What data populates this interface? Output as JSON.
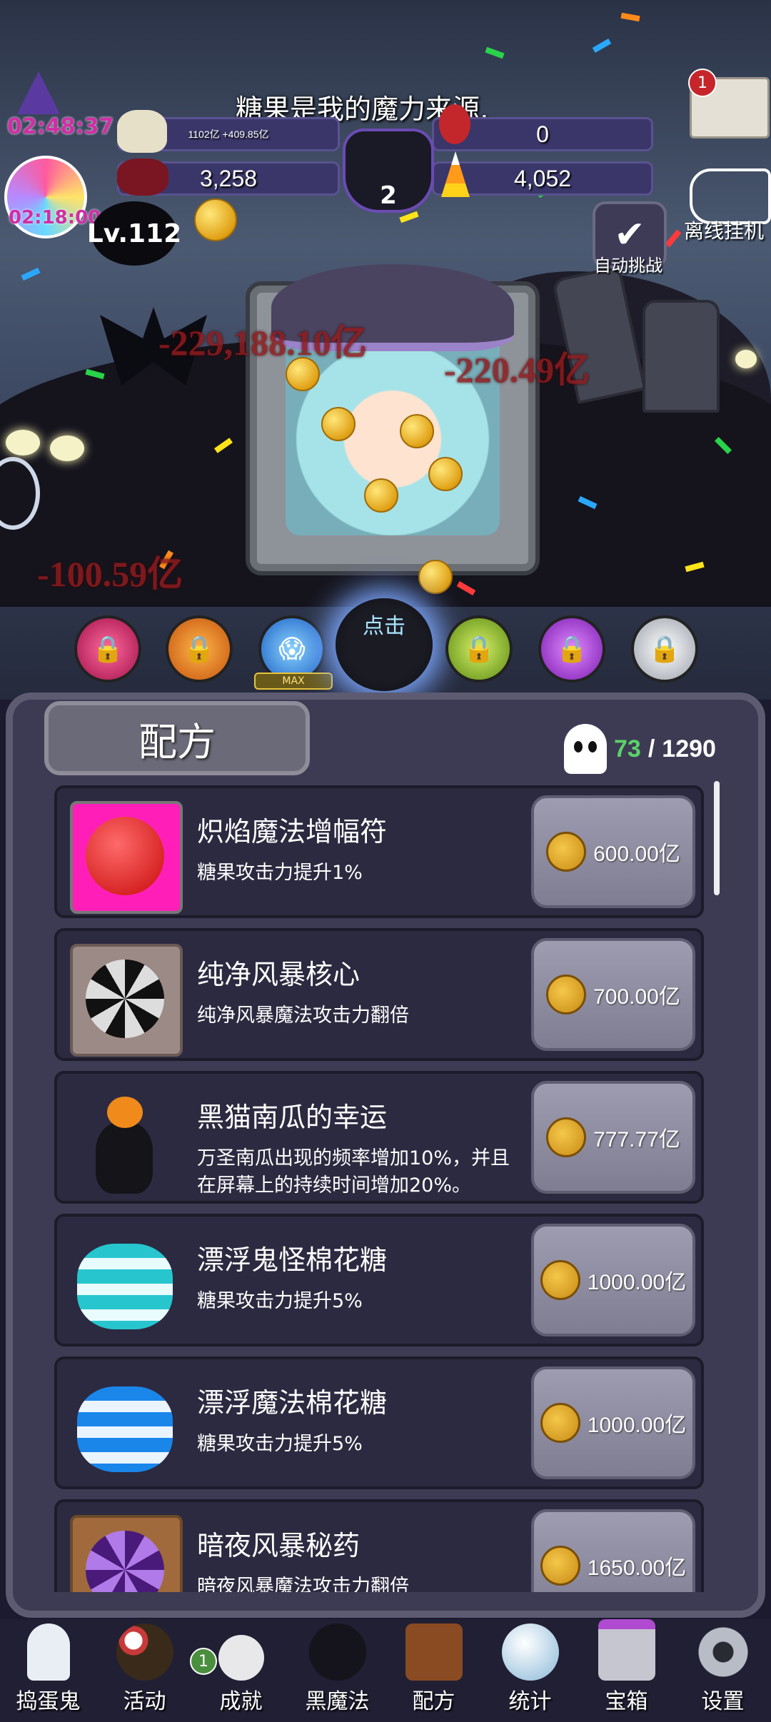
{
  "hud": {
    "title": "糖果是我的魔力来源,",
    "timer_top": "02:48:37",
    "timer_bottom": "02:18:00",
    "level": "Lv.112",
    "candy_small": "1102亿 +409.85亿",
    "stat_right_top": "0",
    "skull_candy": "3,258",
    "candy_corn": "4,052",
    "cauldron_count": "2",
    "auto_challenge": "自动挑战",
    "offline_idle": "离线挂机",
    "mail_badge": "1"
  },
  "damage_texts": [
    "-229,188.10亿",
    "-220.49亿",
    "-100.59亿"
  ],
  "skills": {
    "max_label": "MAX",
    "center_label": "点击"
  },
  "panel": {
    "tab_title": "配方",
    "count_current": "73",
    "count_sep": "/",
    "count_total": "1290"
  },
  "recipes": [
    {
      "name": "炽焰魔法增幅符",
      "desc": "糖果攻击力提升1%",
      "price": "600.00亿",
      "icon": "red-lollipop-icon",
      "color": "#ff1fb8"
    },
    {
      "name": "纯净风暴核心",
      "desc": "纯净风暴魔法攻击力翻倍",
      "price": "700.00亿",
      "icon": "black-swirl-icon",
      "color": "#9c8a86"
    },
    {
      "name": "黑猫南瓜的幸运",
      "desc": "万圣南瓜出现的频率增加10%，并且在屏幕上的持续时间增加20%。",
      "price": "777.77亿",
      "icon": "black-cat-pumpkin-icon",
      "color": "transparent"
    },
    {
      "name": "漂浮鬼怪棉花糖",
      "desc": "糖果攻击力提升5%",
      "price": "1000.00亿",
      "icon": "teal-marshmallow-icon",
      "color": "transparent"
    },
    {
      "name": "漂浮魔法棉花糖",
      "desc": "糖果攻击力提升5%",
      "price": "1000.00亿",
      "icon": "blue-marshmallow-icon",
      "color": "transparent"
    },
    {
      "name": "暗夜风暴秘药",
      "desc": "暗夜风暴魔法攻击力翻倍",
      "price": "1650.00亿",
      "icon": "purple-swirl-icon",
      "color": "#a06a3c"
    }
  ],
  "nav": [
    {
      "label": "捣蛋鬼",
      "icon": "ghost-icon"
    },
    {
      "label": "活动",
      "icon": "eyeball-cake-icon"
    },
    {
      "label": "成就",
      "icon": "skull-trophy-icon",
      "badge": "1"
    },
    {
      "label": "黑魔法",
      "icon": "devil-cat-icon"
    },
    {
      "label": "配方",
      "icon": "recipe-book-icon"
    },
    {
      "label": "统计",
      "icon": "crystal-ball-icon"
    },
    {
      "label": "宝箱",
      "icon": "gift-box-icon"
    },
    {
      "label": "设置",
      "icon": "gear-icon"
    }
  ]
}
